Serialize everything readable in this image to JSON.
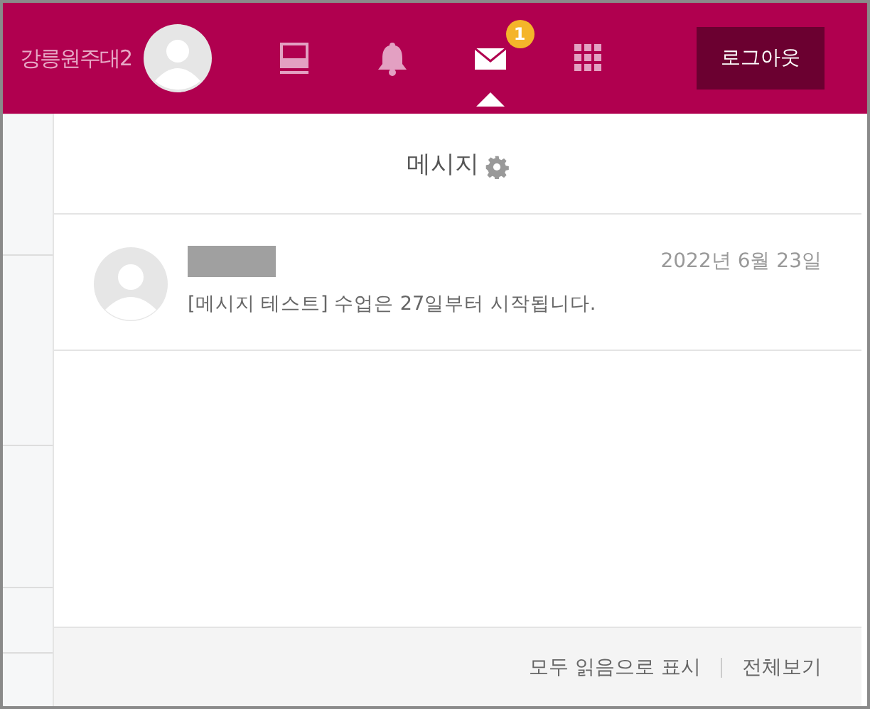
{
  "header": {
    "user_name": "강릉원주대2",
    "icons": [
      {
        "kind": "book",
        "selected": false
      },
      {
        "kind": "bell",
        "selected": false
      },
      {
        "kind": "mail",
        "selected": true,
        "badge": "1"
      },
      {
        "kind": "grid",
        "selected": false
      }
    ],
    "logout_button": "로그아웃"
  },
  "messages_panel": {
    "title": "메시지",
    "messages": [
      {
        "date": "2022년 6월 23일",
        "text": "[메시지 테스트] 수업은 27일부터 시작됩니다."
      }
    ],
    "footer_links": [
      "모두 읽음으로 표시",
      "전체보기"
    ]
  }
}
